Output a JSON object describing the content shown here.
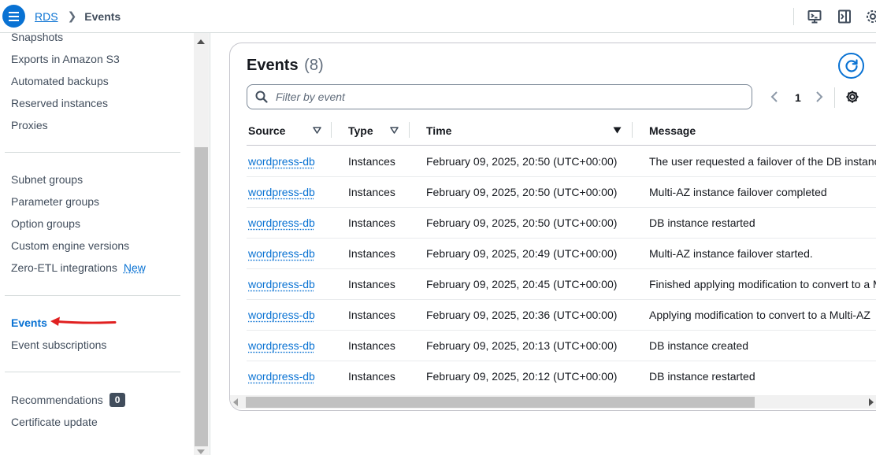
{
  "breadcrumb": {
    "root": "RDS",
    "current": "Events"
  },
  "topbar": {
    "icons": [
      "cloudshell-icon",
      "console-panel-icon",
      "settings-icon"
    ]
  },
  "sidebar": {
    "group1": [
      "Snapshots",
      "Exports in Amazon S3",
      "Automated backups",
      "Reserved instances",
      "Proxies"
    ],
    "group2": [
      "Subnet groups",
      "Parameter groups",
      "Option groups",
      "Custom engine versions"
    ],
    "zero_etl": {
      "label": "Zero-ETL integrations",
      "badge": "New"
    },
    "group3": {
      "events": "Events",
      "subscriptions": "Event subscriptions"
    },
    "recommendations": {
      "label": "Recommendations",
      "count": "0"
    },
    "certificate": "Certificate update"
  },
  "events_panel": {
    "title": "Events",
    "count": "(8)",
    "filter_placeholder": "Filter by event",
    "page": "1",
    "columns": {
      "source": "Source",
      "type": "Type",
      "time": "Time",
      "message": "Message"
    },
    "rows": [
      {
        "source": "wordpress-db",
        "type": "Instances",
        "time": "February 09, 2025, 20:50 (UTC+00:00)",
        "message": "The user requested a failover of the DB instance"
      },
      {
        "source": "wordpress-db",
        "type": "Instances",
        "time": "February 09, 2025, 20:50 (UTC+00:00)",
        "message": "Multi-AZ instance failover completed"
      },
      {
        "source": "wordpress-db",
        "type": "Instances",
        "time": "February 09, 2025, 20:50 (UTC+00:00)",
        "message": "DB instance restarted"
      },
      {
        "source": "wordpress-db",
        "type": "Instances",
        "time": "February 09, 2025, 20:49 (UTC+00:00)",
        "message": "Multi-AZ instance failover started."
      },
      {
        "source": "wordpress-db",
        "type": "Instances",
        "time": "February 09, 2025, 20:45 (UTC+00:00)",
        "message": "Finished applying modification to convert to a Multi-AZ"
      },
      {
        "source": "wordpress-db",
        "type": "Instances",
        "time": "February 09, 2025, 20:36 (UTC+00:00)",
        "message": "Applying modification to convert to a Multi-AZ"
      },
      {
        "source": "wordpress-db",
        "type": "Instances",
        "time": "February 09, 2025, 20:13 (UTC+00:00)",
        "message": "DB instance created"
      },
      {
        "source": "wordpress-db",
        "type": "Instances",
        "time": "February 09, 2025, 20:12 (UTC+00:00)",
        "message": "DB instance restarted"
      }
    ]
  },
  "colors": {
    "accent": "#0972d3",
    "annotation": "#e02020"
  }
}
